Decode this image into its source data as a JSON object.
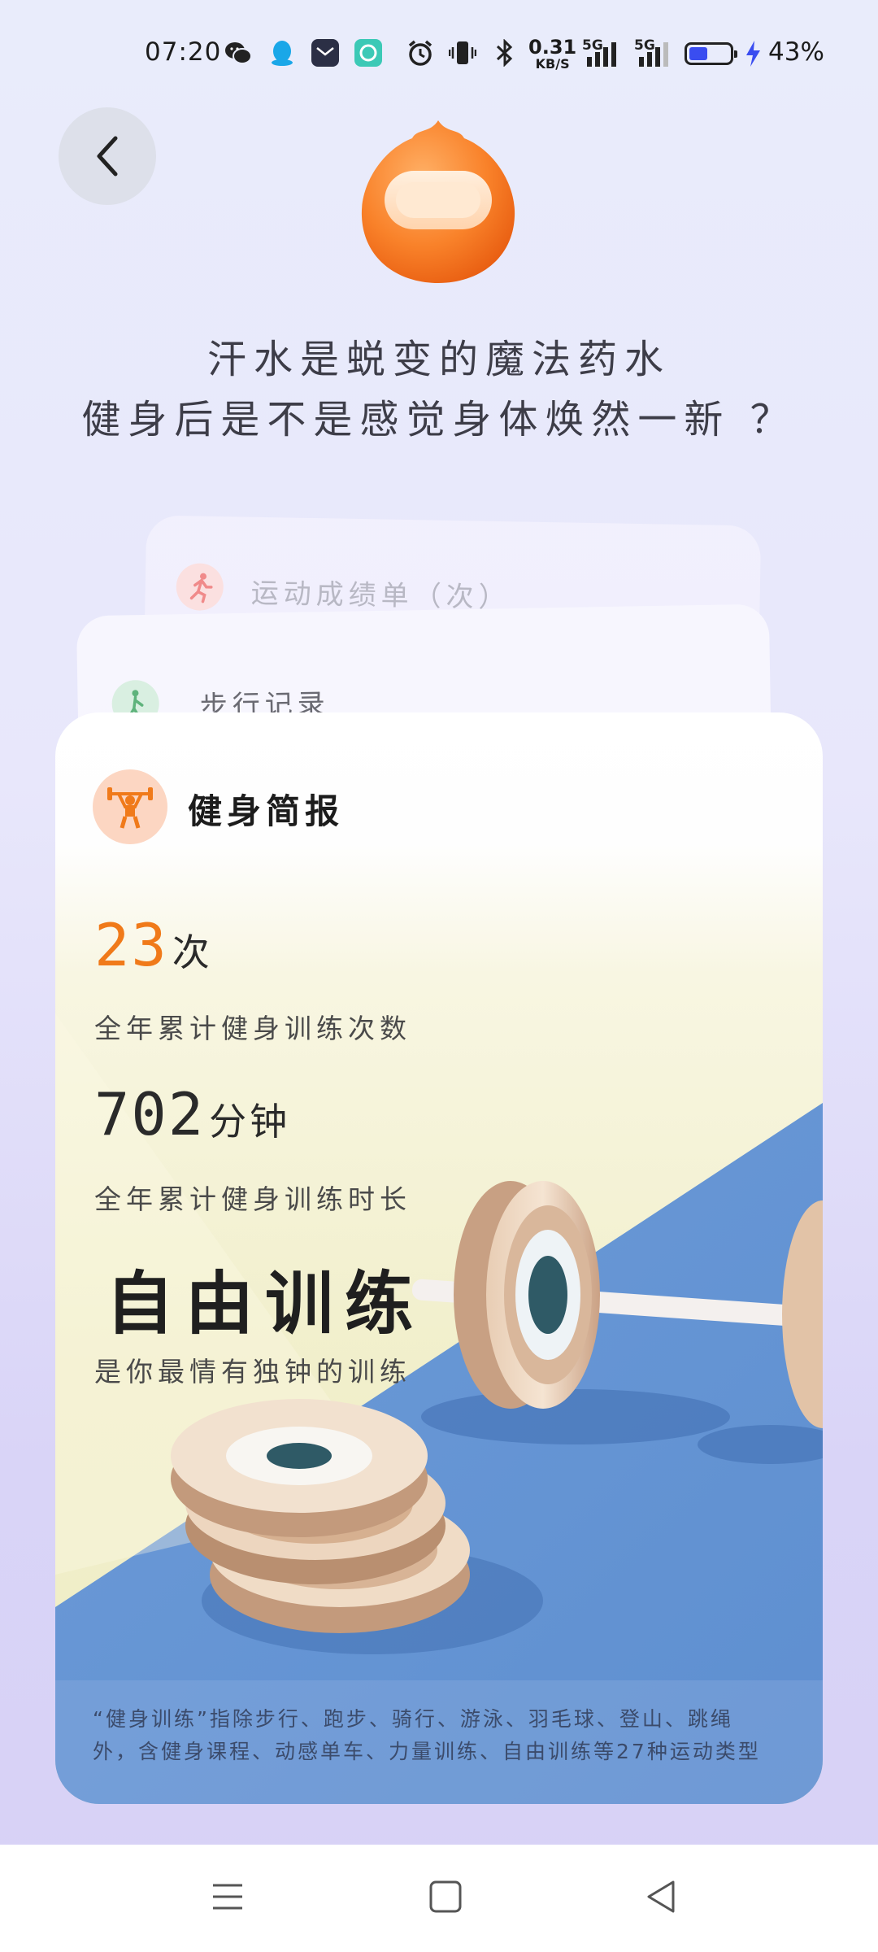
{
  "status_bar": {
    "time": "07:20",
    "net_speed_value": "0.31",
    "net_speed_unit": "KB/S",
    "signal1": "5G",
    "signal2": "5G",
    "battery_pct": "43%",
    "icons": [
      "wechat-icon",
      "qq-icon",
      "mail-icon",
      "chat-icon",
      "alarm-icon",
      "vibrate-icon",
      "bluetooth-icon",
      "signal-icon",
      "battery-icon",
      "charging-icon"
    ]
  },
  "header": {
    "back_icon": "chevron-left-icon",
    "mascot": "orange-mascot-icon",
    "line1": "汗水是蜕变的魔法药水",
    "line2": "健身后是不是感觉身体焕然一新 ？"
  },
  "stack": {
    "card2_title": "运动成绩单（次）",
    "card1_title": "步行记录"
  },
  "card": {
    "title": "健身简报",
    "icon": "weightlifter-icon",
    "count_value": "23",
    "count_unit": "次",
    "count_desc": "全年累计健身训练次数",
    "minutes_value": "702",
    "minutes_unit": "分钟",
    "minutes_desc": "全年累计健身训练时长",
    "favorite": "自由训练",
    "favorite_desc": "是你最情有独钟的训练",
    "footnote_line1": "“健身训练”指除步行、跑步、骑行、游泳、羽毛球、登山、跳绳",
    "footnote_line2": "外，含健身课程、动感单车、力量训练、自由训练等27种运动类型"
  },
  "colors": {
    "accent_orange": "#f07a1a",
    "floor_blue": "#5b8ed0",
    "card_bg": "#ffffff"
  },
  "nav": {
    "menu_icon": "menu-icon",
    "home_icon": "home-square-icon",
    "back_icon": "back-triangle-icon"
  }
}
